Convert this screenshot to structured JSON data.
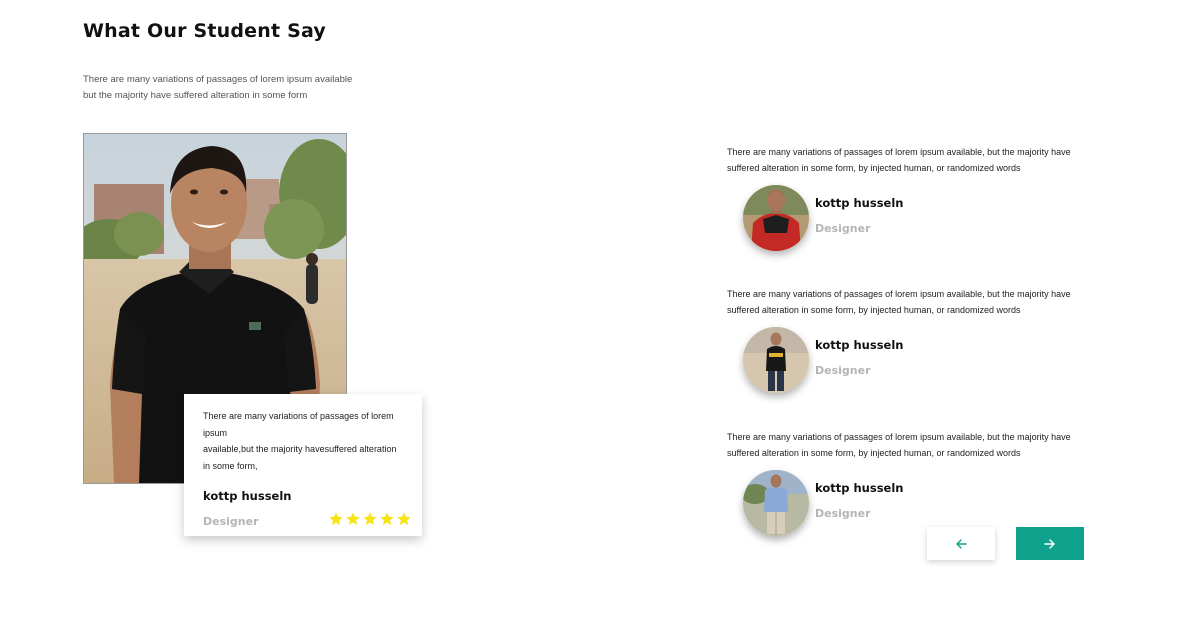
{
  "section": {
    "title": "What Our Student Say",
    "subtitle_line1": "There are many variations of passages of lorem ipsum available",
    "subtitle_line2": "but the majority have suffered alteration in some form"
  },
  "featured": {
    "quote_line1": "There are many variations of passages of lorem ipsum",
    "quote_line2": "available,but the majority havesuffered alteration",
    "quote_line3": "in some form,",
    "name": "kottp husseln",
    "role": "Designer",
    "rating": 5,
    "star_color": "#f5e416"
  },
  "testimonials": [
    {
      "quote_line1": "There are many variations of passages of lorem ipsum available, but the majority have",
      "quote_line2": "suffered alteration in some form, by injected human, or randomized words",
      "name": "kottp husseln",
      "role": "Designer"
    },
    {
      "quote_line1": "There are many variations of passages of lorem ipsum available, but the majority have",
      "quote_line2": "suffered alteration in some form, by injected human, or randomized words",
      "name": "kottp husseln",
      "role": "Designer"
    },
    {
      "quote_line1": "There are many variations of passages of lorem ipsum available, but the majority have",
      "quote_line2": "suffered alteration in some form, by injected human, or randomized words",
      "name": "kottp husseln",
      "role": "Designer"
    }
  ],
  "nav": {
    "prev_icon": "arrow-left-icon",
    "next_icon": "arrow-right-icon",
    "accent_color": "#0ea18c"
  }
}
